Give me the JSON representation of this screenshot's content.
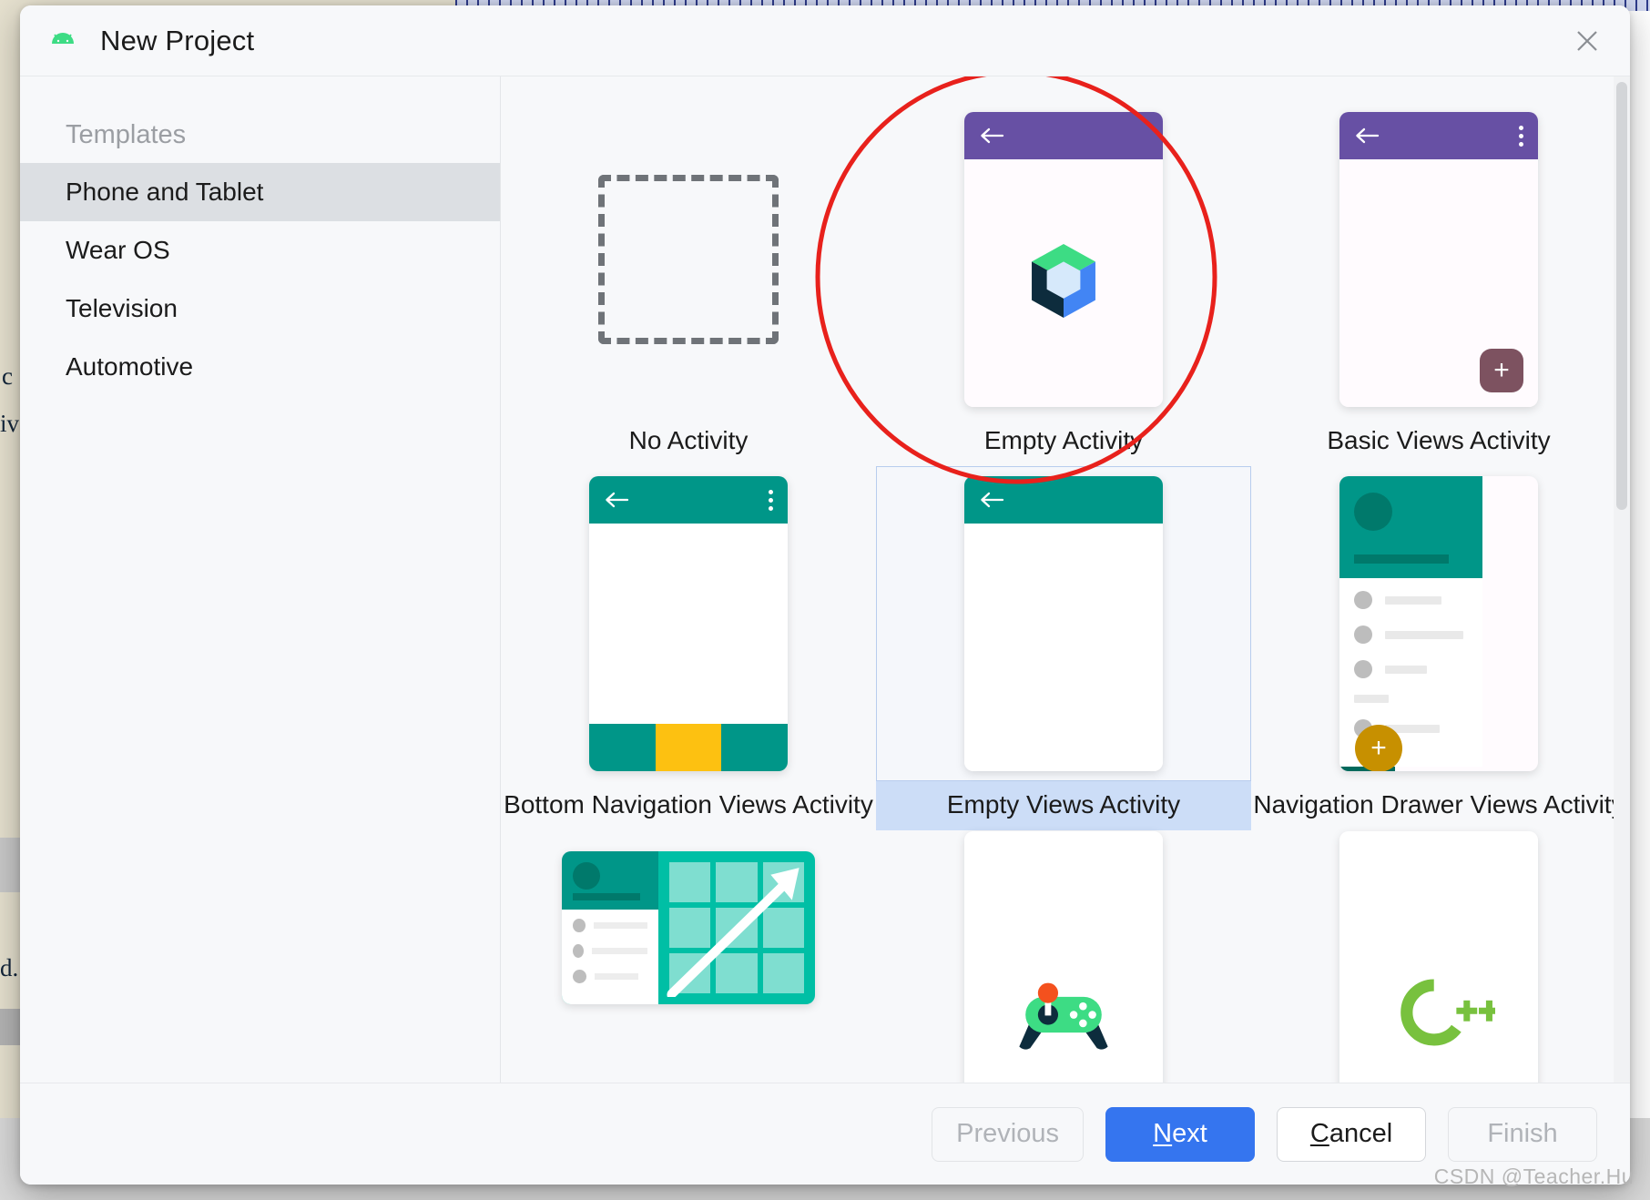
{
  "window": {
    "title": "New Project",
    "app_icon": "android-icon",
    "close_icon": "close-icon"
  },
  "sidebar": {
    "header": "Templates",
    "items": [
      {
        "label": "Phone and Tablet",
        "selected": true
      },
      {
        "label": "Wear OS",
        "selected": false
      },
      {
        "label": "Television",
        "selected": false
      },
      {
        "label": "Automotive",
        "selected": false
      }
    ]
  },
  "templates": [
    {
      "label": "No Activity",
      "thumb": "no-activity",
      "selected": false
    },
    {
      "label": "Empty Activity",
      "thumb": "empty-activity",
      "selected": false
    },
    {
      "label": "Basic Views Activity",
      "thumb": "basic-views",
      "selected": false
    },
    {
      "label": "Bottom Navigation Views Activity",
      "thumb": "bottom-nav-views",
      "selected": false
    },
    {
      "label": "Empty Views Activity",
      "thumb": "empty-views",
      "selected": true
    },
    {
      "label": "Navigation Drawer Views Activity",
      "thumb": "nav-drawer-views",
      "selected": false
    },
    {
      "label": "",
      "thumb": "responsive-views",
      "selected": false
    },
    {
      "label": "",
      "thumb": "game-activity",
      "selected": false
    },
    {
      "label": "",
      "thumb": "native-cpp",
      "selected": false
    }
  ],
  "footer": {
    "previous": {
      "label": "Previous",
      "disabled": true
    },
    "next": {
      "label": "Next",
      "mnemonic": "N",
      "primary": true
    },
    "cancel": {
      "label": "Cancel",
      "mnemonic": "C"
    },
    "finish": {
      "label": "Finish",
      "disabled": true
    }
  },
  "watermark": "CSDN @Teacher.Hu",
  "colors": {
    "accent_blue": "#3575ef",
    "selection_blue": "#ccddf7",
    "selection_border": "#b8cdee",
    "sidebar_selected": "#dcdfe3",
    "material_purple": "#6750a4",
    "material_teal": "#009688",
    "fab_maroon": "#7d5260",
    "fab_gold": "#c79000",
    "bottomnav_yellow": "#fdc111",
    "compose_green": "#3ddc84",
    "compose_blue": "#4285f4",
    "compose_navy": "#0d2c3d",
    "cpp_green": "#78c13e",
    "joystick_orange": "#f4511e",
    "annotation_red": "#e8211c"
  },
  "background_doc": {
    "fragment_1": "c",
    "fragment_2": "iv",
    "fragment_3": "d."
  }
}
